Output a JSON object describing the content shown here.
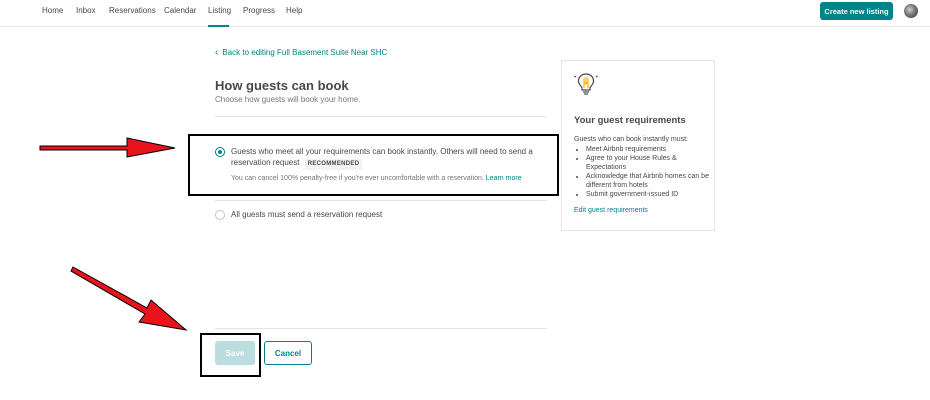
{
  "nav": {
    "items": [
      {
        "label": "Home"
      },
      {
        "label": "Inbox"
      },
      {
        "label": "Reservations"
      },
      {
        "label": "Calendar"
      },
      {
        "label": "Listing",
        "active": true
      },
      {
        "label": "Progress"
      },
      {
        "label": "Help"
      }
    ],
    "create_label": "Create new listing",
    "accent_color": "#008489"
  },
  "main": {
    "back_link": "Back to editing Full Basement Suite Near SHC",
    "title": "How guests can book",
    "subtitle": "Choose how guests will book your home.",
    "options": [
      {
        "label_line1": "Guests who meet all your requirements can book instantly. Others will need to send a",
        "label_line2": "reservation request",
        "badge": "RECOMMENDED",
        "note": "You can cancel 100% penalty-free if you're ever uncomfortable with a reservation.",
        "note_link": "Learn more",
        "selected": true
      },
      {
        "label_line1": "All guests must send a reservation request",
        "selected": false
      }
    ],
    "save_label": "Save",
    "cancel_label": "Cancel"
  },
  "sidebar": {
    "icon": "lightbulb-icon",
    "title": "Your guest requirements",
    "intro": "Guests who can book instantly must:",
    "requirements": [
      "Meet Airbnb requirements",
      "Agree to your House Rules & Expectations",
      "Acknowledge that Airbnb homes can be different from hotels",
      "Submit government-issued ID"
    ],
    "link": "Edit guest requirements"
  },
  "annotations": {
    "arrow_color": "#e8141b"
  }
}
